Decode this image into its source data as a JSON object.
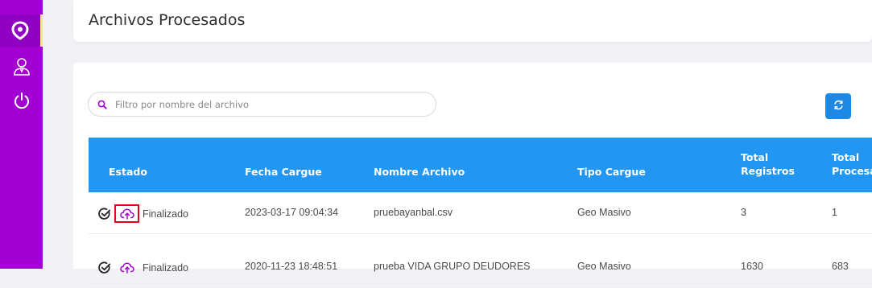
{
  "sidebar": {
    "items": [
      {
        "icon": "location-pin-icon",
        "active": true
      },
      {
        "icon": "user-icon",
        "active": false
      },
      {
        "icon": "power-icon",
        "active": false
      }
    ],
    "accent": "#a100d1"
  },
  "header": {
    "title": "Archivos Procesados"
  },
  "search": {
    "placeholder": "Filtro por nombre del archivo",
    "value": ""
  },
  "table": {
    "columns": {
      "estado": "Estado",
      "fecha": "Fecha Cargue",
      "nombre": "Nombre Archivo",
      "tipo": "Tipo Cargue",
      "total_registros_1": "Total",
      "total_registros_2": "Registros",
      "total_procesados_1": "Total",
      "total_procesados_2": "Procesa"
    },
    "rows": [
      {
        "estado": "Finalizado",
        "fecha": "2023-03-17 09:04:34",
        "nombre": "pruebayanbal.csv",
        "tipo": "Geo Masivo",
        "total_registros": "3",
        "total_procesados": "1"
      },
      {
        "estado": "Finalizado",
        "fecha": "2020-11-23 18:48:51",
        "nombre": "prueba VIDA GRUPO DEUDORES",
        "tipo": "Geo Masivo",
        "total_registros": "1630",
        "total_procesados": "683"
      }
    ]
  },
  "colors": {
    "header_bg": "#2196f3",
    "refresh_button": "#1e88e5",
    "highlight_border": "#e8001c",
    "upload_icon": "#a100d1"
  }
}
